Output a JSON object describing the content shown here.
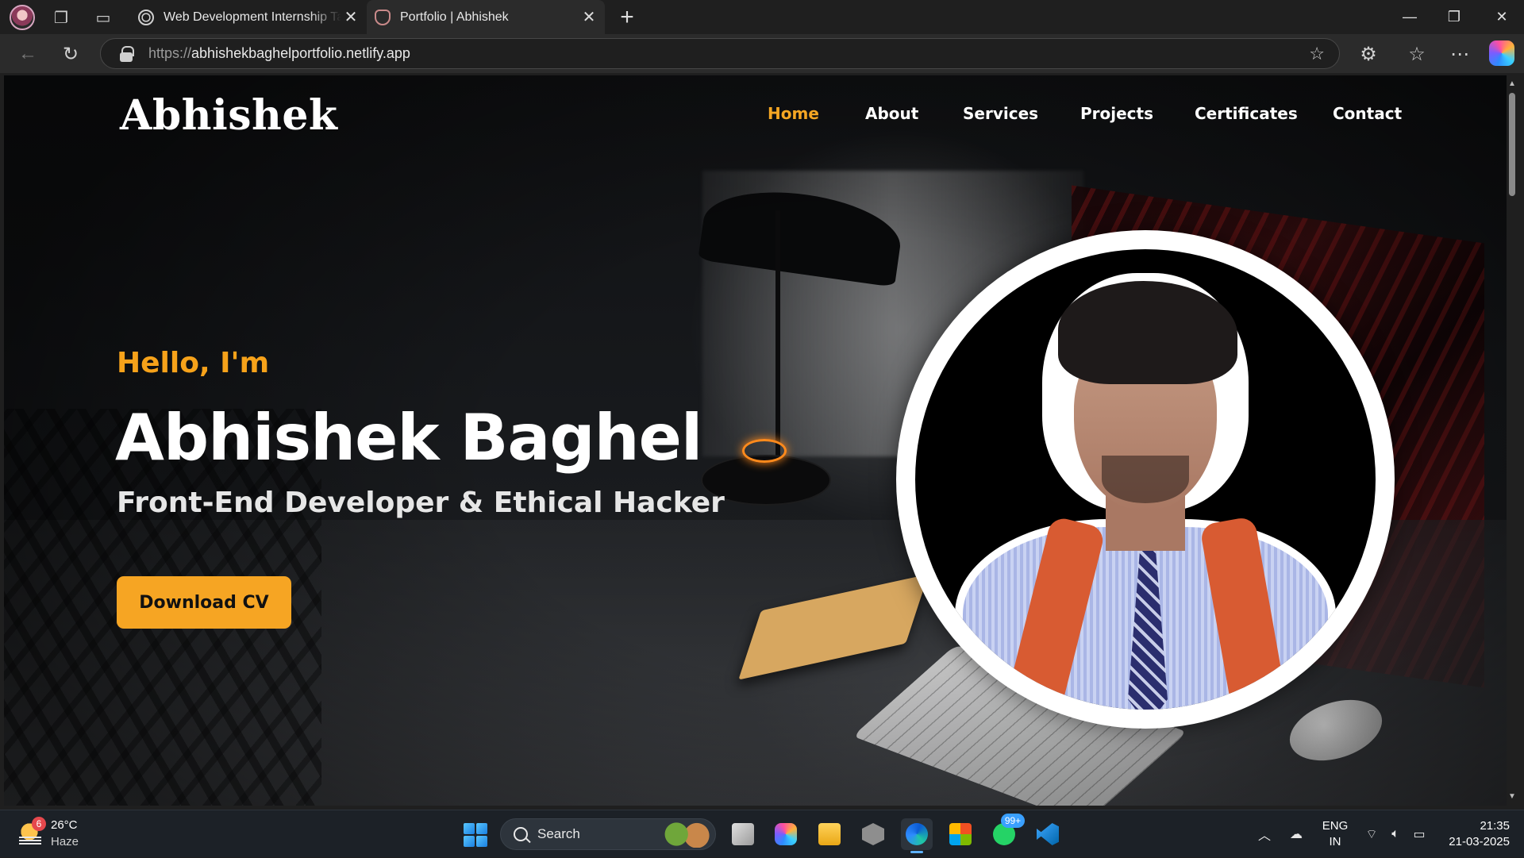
{
  "browser": {
    "tabs": [
      {
        "title": "Web Development Internship Task",
        "active": false
      },
      {
        "title": "Portfolio | Abhishek",
        "active": true
      }
    ],
    "url_prefix": "https://",
    "url_host": "abhishekbaghelportfolio.netlify.app"
  },
  "site": {
    "brand": "Abhishek",
    "nav": [
      {
        "label": "Home",
        "active": true
      },
      {
        "label": "About",
        "active": false
      },
      {
        "label": "Services",
        "active": false
      },
      {
        "label": "Projects",
        "active": false
      },
      {
        "label": "Certificates",
        "active": false
      },
      {
        "label": "Contact",
        "active": false
      }
    ],
    "hero": {
      "greeting": "Hello, I'm",
      "name": "Abhishek Baghel",
      "role": "Front-End Developer & Ethical Hacker",
      "cta": "Download CV"
    },
    "colors": {
      "accent": "#f6a523",
      "background": "#0e0f11",
      "text": "#ffffff"
    }
  },
  "taskbar": {
    "weather": {
      "badge": "6",
      "temp": "26°C",
      "condition": "Haze"
    },
    "search_label": "Search",
    "apps": [
      "task-view",
      "copilot",
      "file-explorer",
      "app",
      "edge",
      "store",
      "whatsapp",
      "vscode"
    ],
    "whatsapp_badge": "99+",
    "language": {
      "line1": "ENG",
      "line2": "IN"
    },
    "clock": {
      "time": "21:35",
      "date": "21-03-2025"
    }
  }
}
